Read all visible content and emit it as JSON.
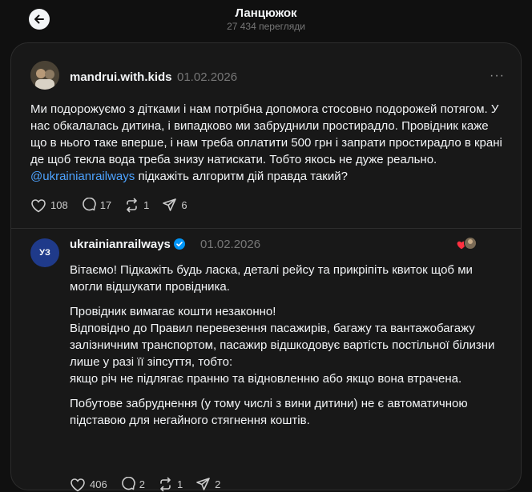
{
  "header": {
    "title": "Ланцюжок",
    "views": "27 434 перегляди"
  },
  "post1": {
    "username": "mandrui.with.kids",
    "date": "01.02.2026",
    "text_main": "Ми подорожуємо з дітками і нам потрібна допомога стосовно подорожей потягом. У нас обкалалась дитина, і випадково ми забруднили простирадло. Провідник каже що в нього таке вперше, і нам треба оплатити 500 грн і запрати простирадло в крані де щоб текла вода треба знизу натискати. Тобто якось не дуже реально. ",
    "mention": "@ukrainianrailways",
    "text_tail": " підкажіть алгоритм дій правда такий?",
    "likes": "108",
    "replies": "17",
    "reposts": "1",
    "shares": "6"
  },
  "post2": {
    "username": "ukrainianrailways",
    "avatar_text": "УЗ",
    "date": "01.02.2026",
    "paragraph1": "Вітаємо! Підкажіть будь ласка, деталі рейсу та прикріпіть квиток щоб ми могли відшукати провідника.",
    "paragraph2_line1": "Провідник вимагає кошти незаконно!",
    "paragraph2_line2": "Відповідно до Правил перевезення пасажирів, багажу та вантажобагажу залізничним транспортом, пасажир відшкодовує вартість постільної білизни лише у разі її зіпсуття, тобто:",
    "paragraph2_line3": "якщо річ не підлягає пранню та відновленню або якщо вона втрачена.",
    "paragraph3": "Побутове забруднення (у тому числі з вини дитини) не є автоматичною підставою для негайного стягнення коштів.",
    "likes": "406",
    "replies": "2",
    "reposts": "1",
    "shares": "2"
  },
  "colors": {
    "background": "#101010",
    "card": "#181818",
    "mention": "#4da3ff",
    "verified": "#0095f6",
    "liked_heart": "#ff3040"
  }
}
